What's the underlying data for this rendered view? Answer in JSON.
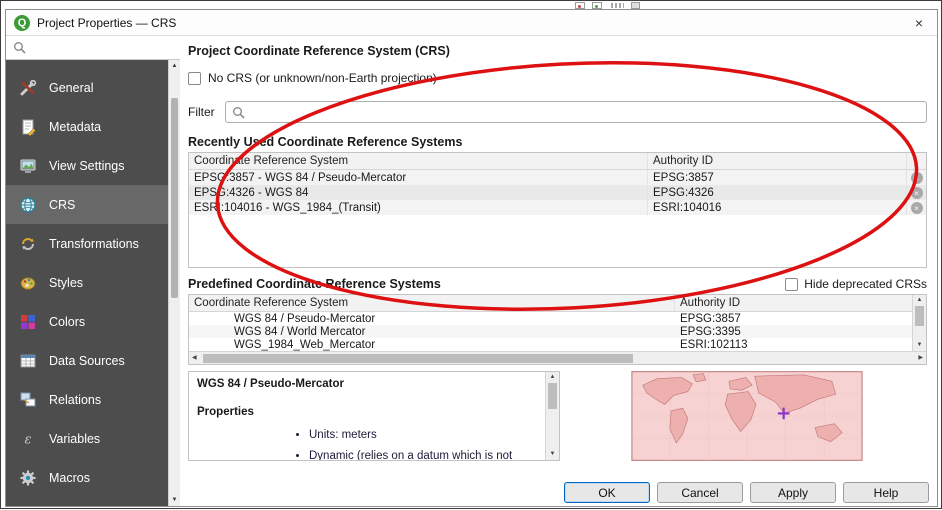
{
  "window": {
    "title": "Project Properties — CRS",
    "close_glyph": "×"
  },
  "icons": {
    "qgis_logo_glyph": "Q",
    "scroll_up": "▲",
    "scroll_down": "▼",
    "scroll_left": "◀",
    "scroll_right": "▶",
    "remove_glyph": "×"
  },
  "sidebar": {
    "selected_item": "CRS",
    "items": [
      {
        "label": "General"
      },
      {
        "label": "Metadata"
      },
      {
        "label": "View Settings"
      },
      {
        "label": "CRS"
      },
      {
        "label": "Transformations"
      },
      {
        "label": "Styles"
      },
      {
        "label": "Colors"
      },
      {
        "label": "Data Sources"
      },
      {
        "label": "Relations"
      },
      {
        "label": "Variables"
      },
      {
        "label": "Macros"
      }
    ]
  },
  "main": {
    "title": "Project Coordinate Reference System (CRS)",
    "no_crs_label": "No CRS (or unknown/non-Earth projection)",
    "no_crs_checked": false,
    "filter_label": "Filter",
    "filter_value": "",
    "recent": {
      "title": "Recently Used Coordinate Reference Systems",
      "columns": [
        "Coordinate Reference System",
        "Authority ID"
      ],
      "rows": [
        {
          "crs": "EPSG:3857 - WGS 84 / Pseudo-Mercator",
          "authority": "EPSG:3857"
        },
        {
          "crs": "EPSG:4326 - WGS 84",
          "authority": "EPSG:4326"
        },
        {
          "crs": "ESRI:104016 - WGS_1984_(Transit)",
          "authority": "ESRI:104016"
        }
      ]
    },
    "predefined": {
      "title": "Predefined Coordinate Reference Systems",
      "hide_deprecated_label": "Hide deprecated CRSs",
      "hide_deprecated_checked": false,
      "columns": [
        "Coordinate Reference System",
        "Authority ID"
      ],
      "rows": [
        {
          "crs": "WGS 84 / Pseudo-Mercator",
          "authority": "EPSG:3857"
        },
        {
          "crs": "WGS 84 / World Mercator",
          "authority": "EPSG:3395"
        },
        {
          "crs": "WGS_1984_Web_Mercator",
          "authority": "ESRI:102113"
        }
      ]
    },
    "details": {
      "crs_name": "WGS 84 / Pseudo-Mercator",
      "properties_title": "Properties",
      "bullets": [
        "Units: meters",
        "Dynamic (relies on a datum which is not plate-fixed)"
      ]
    }
  },
  "footer": {
    "buttons": [
      "OK",
      "Cancel",
      "Apply",
      "Help"
    ]
  },
  "colors": {
    "sidebar_bg": "#4d4d4d",
    "sidebar_selected_bg": "#686868",
    "annotation_red": "#dd1111",
    "map_pink": "#f7d2d2",
    "marker_purple": "#8d33cc",
    "ok_focus_blue": "#0067c0",
    "logo_green": "#3b9b35"
  }
}
